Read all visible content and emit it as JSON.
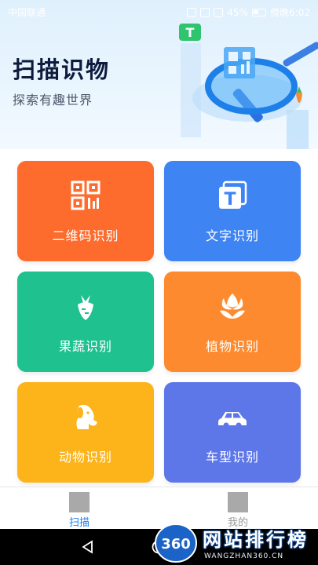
{
  "status_bar": {
    "carrier": "中国联通",
    "battery": "45%",
    "time": "傍晚6:02"
  },
  "header": {
    "title": "扫描识物",
    "subtitle": "探索有趣世界"
  },
  "colors": {
    "qr": "#fd6b2d",
    "text": "#3f84f3",
    "produce": "#1fc18f",
    "plant": "#fd8a2e",
    "animal": "#fdb41a",
    "car": "#5e77e8",
    "tab_active": "#1f7ef0",
    "tab_inactive": "#9a9a9a"
  },
  "features": [
    {
      "label": "二维码识别",
      "icon": "qr-code-icon"
    },
    {
      "label": "文字识别",
      "icon": "text-t-icon"
    },
    {
      "label": "果蔬识别",
      "icon": "carrot-icon"
    },
    {
      "label": "植物识别",
      "icon": "flower-icon"
    },
    {
      "label": "动物识别",
      "icon": "dog-icon"
    },
    {
      "label": "车型识别",
      "icon": "car-icon"
    }
  ],
  "tabs": [
    {
      "label": "扫描",
      "active": true
    },
    {
      "label": "我的",
      "active": false
    }
  ],
  "watermark": {
    "badge": "360",
    "text": "网站排行榜",
    "sub": "WANGZHAN360.CN"
  }
}
